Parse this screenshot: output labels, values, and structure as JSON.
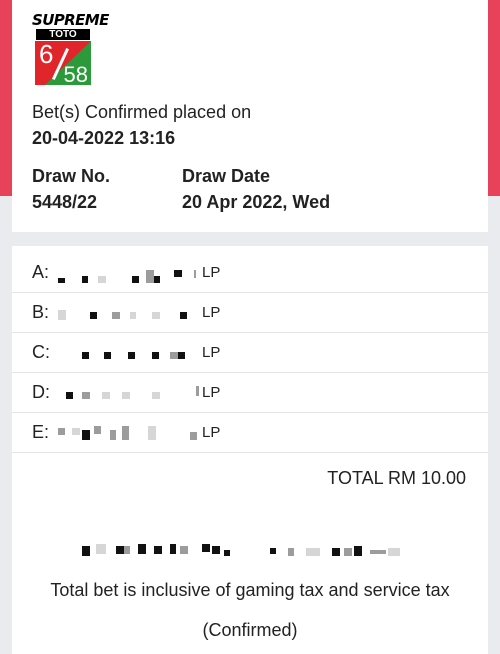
{
  "logo": {
    "brand": "SUPREME",
    "sub": "TOTO",
    "numbers_left": "6",
    "numbers_right": "58"
  },
  "confirmation": {
    "placed_label": "Bet(s) Confirmed placed on",
    "placed_datetime": "20-04-2022 13:16"
  },
  "draw": {
    "no_label": "Draw No.",
    "no_value": "5448/22",
    "date_label": "Draw Date",
    "date_value": "20 Apr 2022, Wed"
  },
  "bets": [
    {
      "letter": "A:",
      "suffix": "LP"
    },
    {
      "letter": "B:",
      "suffix": "LP"
    },
    {
      "letter": "C:",
      "suffix": "LP"
    },
    {
      "letter": "D:",
      "suffix": "LP"
    },
    {
      "letter": "E:",
      "suffix": "LP"
    }
  ],
  "summary": {
    "total": "TOTAL RM 10.00",
    "tax_note": "Total bet is inclusive of gaming tax and service tax",
    "status": "(Confirmed)"
  },
  "colors": {
    "side_accent": "#e8425a",
    "logo_red": "#e0262b",
    "logo_green": "#2c9a3a"
  }
}
